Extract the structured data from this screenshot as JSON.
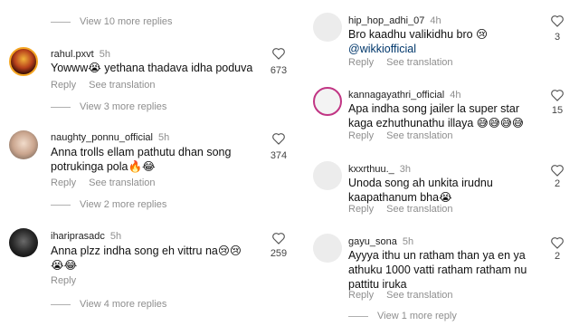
{
  "left": {
    "top_view_replies": "View 10 more replies",
    "comments": [
      {
        "username": "rahul.pxvt",
        "time": "5h",
        "text": "Yowww😭 yethana thadava idha poduva",
        "reply": "Reply",
        "translate": "See translation",
        "likes": "673",
        "view_replies": "View 3 more replies",
        "avatar": "avatar-fire"
      },
      {
        "username": "naughty_ponnu_official",
        "time": "5h",
        "text": "Anna trolls ellam pathutu dhan song potrukinga pola🔥😂",
        "reply": "Reply",
        "translate": "See translation",
        "likes": "374",
        "view_replies": "View 2 more replies",
        "avatar": "avatar-girl"
      },
      {
        "username": "ihariprasadc",
        "time": "5h",
        "text": "Anna plzz indha song eh vittru na😢😢😭😂",
        "reply": "Reply",
        "likes": "259",
        "view_replies": "View 4 more replies",
        "avatar": "avatar-dark"
      }
    ]
  },
  "right": {
    "comments": [
      {
        "username": "hip_hop_adhi_07",
        "time": "4h",
        "text": "Bro kaadhu valikidhu bro 😢",
        "mention": "@wikkiofficial",
        "reply": "Reply",
        "translate": "See translation",
        "likes": "3"
      },
      {
        "username": "kannagayathri_official",
        "time": "4h",
        "text": "Apa indha song jailer la super star kaga ezhuthunathu illaya 😅😅😅😅",
        "reply": "Reply",
        "translate": "See translation",
        "likes": "15"
      },
      {
        "username": "kxxrthuu._",
        "time": "3h",
        "text": "Unoda song ah unkita irudnu kaapathanum bha😭",
        "reply": "Reply",
        "translate": "See translation",
        "likes": "2"
      },
      {
        "username": "gayu_sona",
        "time": "5h",
        "text": "Ayyya ithu un ratham than ya en ya athuku 1000 vatti ratham ratham nu pattitu iruka",
        "reply": "Reply",
        "translate": "See translation",
        "likes": "2",
        "view_replies": "View 1 more reply"
      }
    ]
  },
  "icons": {
    "like": "heart-outline-icon"
  }
}
